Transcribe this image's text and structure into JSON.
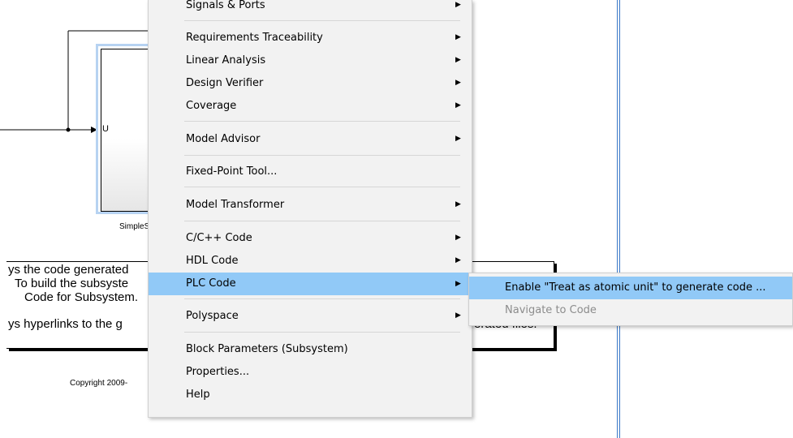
{
  "model": {
    "port_label": "U",
    "block_name": "SimpleS",
    "note_lines": [
      "ys the code generated",
      "To build the subsyste",
      "Code for Subsystem.",
      "ys hyperlinks to the g",
      "erated files."
    ],
    "copyright": "Copyright 2009-"
  },
  "context_menu": {
    "items": [
      {
        "label": "Signals & Ports",
        "submenu": true
      },
      {
        "label": "Requirements Traceability",
        "submenu": true
      },
      {
        "label": "Linear Analysis",
        "submenu": true
      },
      {
        "label": "Design Verifier",
        "submenu": true
      },
      {
        "label": "Coverage",
        "submenu": true
      },
      {
        "label": "Model Advisor",
        "submenu": true
      },
      {
        "label": "Fixed-Point Tool...",
        "submenu": false
      },
      {
        "label": "Model Transformer",
        "submenu": true
      },
      {
        "label": "C/C++ Code",
        "submenu": true
      },
      {
        "label": "HDL Code",
        "submenu": true
      },
      {
        "label": "PLC Code",
        "submenu": true,
        "active": true
      },
      {
        "label": "Polyspace",
        "submenu": true
      },
      {
        "label": "Block Parameters (Subsystem)",
        "submenu": false
      },
      {
        "label": "Properties...",
        "submenu": false
      },
      {
        "label": "Help",
        "submenu": false
      }
    ]
  },
  "submenu": {
    "items": [
      {
        "label": "Enable \"Treat as atomic unit\" to generate code ...",
        "active": true
      },
      {
        "label": "Navigate to Code",
        "disabled": true
      }
    ]
  },
  "arrow_glyph": "▶"
}
